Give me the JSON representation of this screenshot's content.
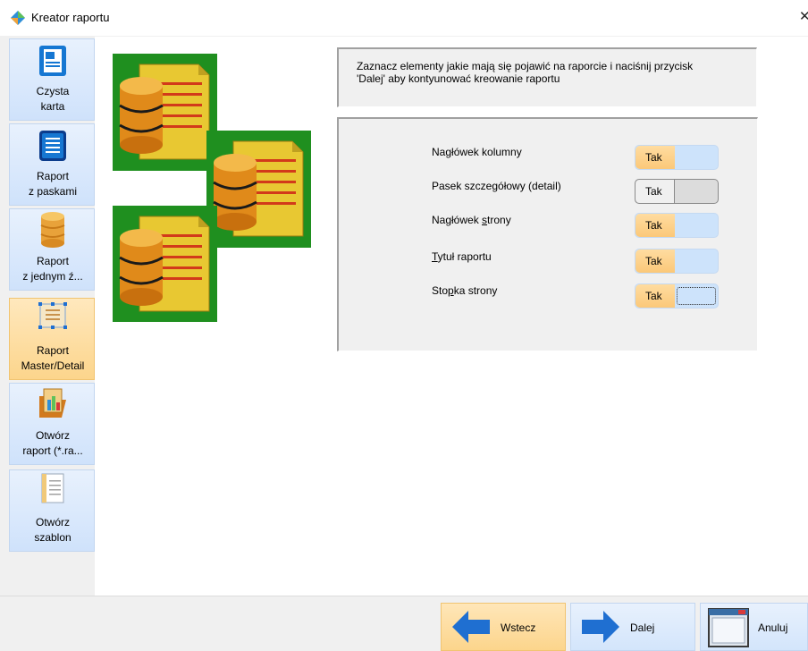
{
  "window": {
    "title": "Kreator raportu",
    "close_glyph": "✕"
  },
  "sidebar": {
    "items": [
      {
        "line1": "Czysta",
        "line2": "karta",
        "icon": "blank-page-icon",
        "active": false
      },
      {
        "line1": "Raport",
        "line2": "z paskami",
        "icon": "striped-report-icon",
        "active": false
      },
      {
        "line1": "Raport",
        "line2": "z jednym ź...",
        "icon": "database-icon",
        "active": false
      },
      {
        "line1": "Raport",
        "line2": "Master/Detail",
        "icon": "master-detail-icon",
        "active": true
      },
      {
        "line1": "Otwórz",
        "line2": "raport (*.ra...",
        "icon": "open-report-icon",
        "active": false
      },
      {
        "line1": "Otwórz",
        "line2": "szablon",
        "icon": "open-template-icon",
        "active": false
      }
    ]
  },
  "info": {
    "line1": "Zaznacz elementy jakie mają się pojawić na raporcie i naciśnij przycisk",
    "line2": "'Dalej' aby kontyunować kreowanie raportu"
  },
  "options": [
    {
      "pre": "Na",
      "accel": "g",
      "post": "łówek kolumny",
      "toggle": "Tak",
      "on": true,
      "focused": false
    },
    {
      "pre": "Pasek szczegółowy (detail)",
      "accel": "",
      "post": "",
      "toggle": "Tak",
      "on": false,
      "focused": false
    },
    {
      "pre": "Nagłówek ",
      "accel": "s",
      "post": "trony",
      "toggle": "Tak",
      "on": true,
      "focused": false
    },
    {
      "pre": "",
      "accel": "T",
      "post": "ytuł raportu",
      "toggle": "Tak",
      "on": true,
      "focused": false
    },
    {
      "pre": "Sto",
      "accel": "p",
      "post": "ka strony",
      "toggle": "Tak",
      "on": true,
      "focused": true
    }
  ],
  "buttons": {
    "back": "Wstecz",
    "next": "Dalej",
    "cancel": "Anuluj"
  },
  "colors": {
    "accent_blue": "#1f6fd1",
    "active_orange": "#fcd58c",
    "tile_green": "#1f8f1f"
  }
}
